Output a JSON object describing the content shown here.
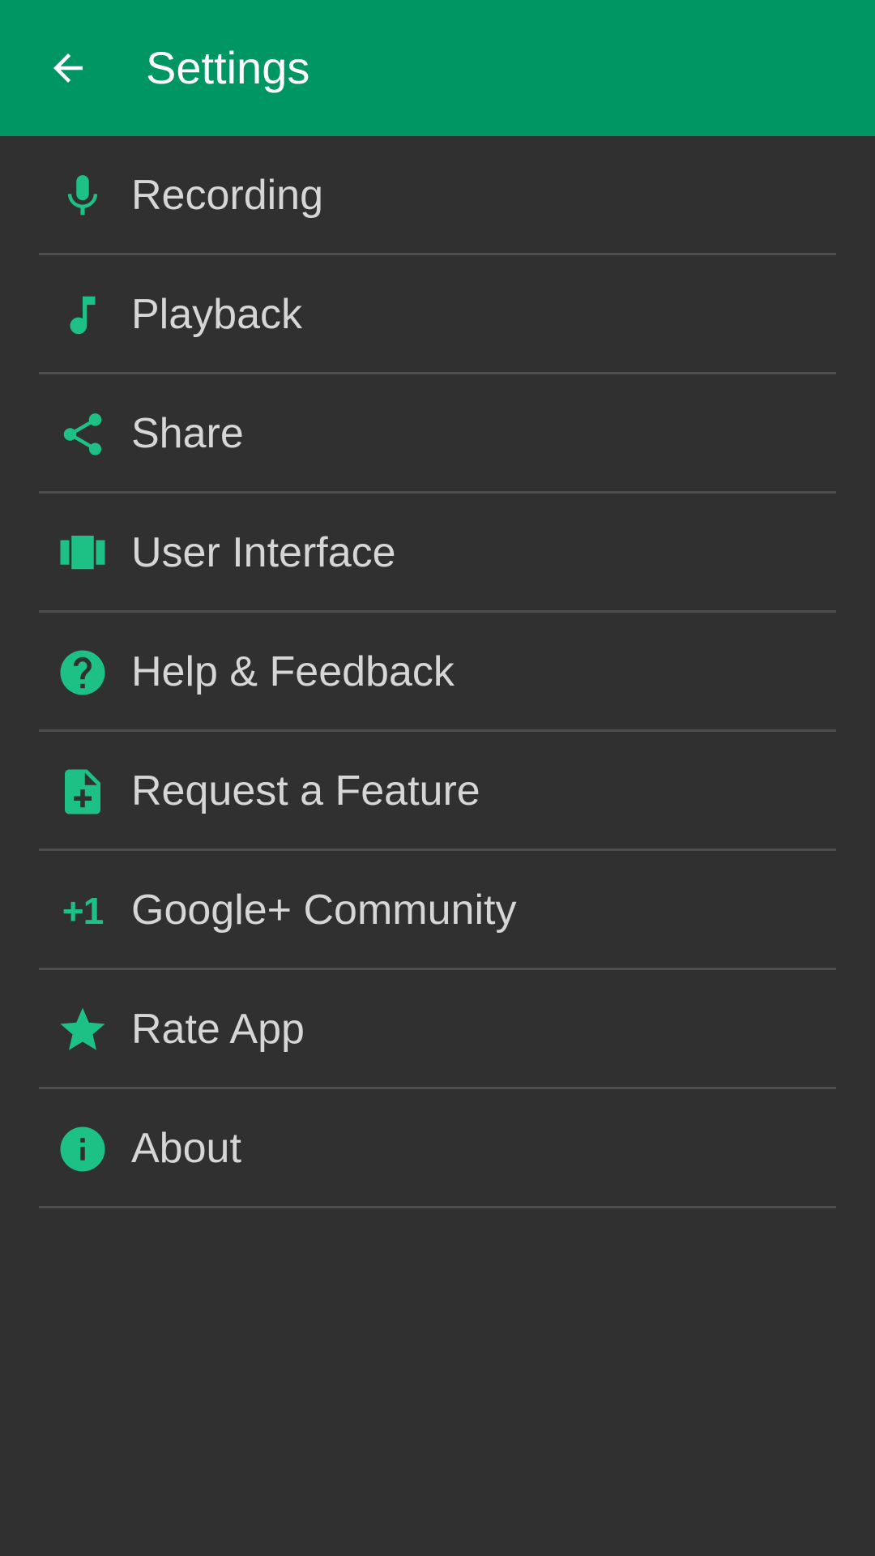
{
  "app_bar": {
    "title": "Settings",
    "background_color": "#009663",
    "back_icon": "arrow-left-icon"
  },
  "accent_color": "#1ec185",
  "items": [
    {
      "label": "Recording",
      "icon": "microphone-icon"
    },
    {
      "label": "Playback",
      "icon": "music-note-icon"
    },
    {
      "label": "Share",
      "icon": "share-icon"
    },
    {
      "label": "User Interface",
      "icon": "view-carousel-icon"
    },
    {
      "label": "Help & Feedback",
      "icon": "help-circle-icon"
    },
    {
      "label": "Request a Feature",
      "icon": "note-add-icon"
    },
    {
      "label": "Google+ Community",
      "icon": "plus-one-icon",
      "icon_text": "+1"
    },
    {
      "label": "Rate App",
      "icon": "star-icon"
    },
    {
      "label": "About",
      "icon": "info-icon"
    }
  ]
}
